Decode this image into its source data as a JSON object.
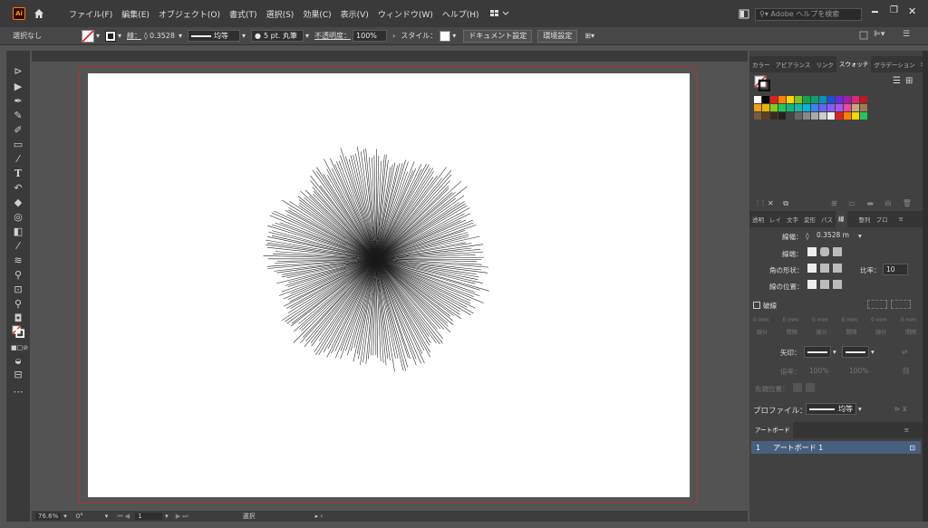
{
  "app": {
    "logo_text": "Ai"
  },
  "menu": {
    "items": [
      "ファイル(F)",
      "編集(E)",
      "オブジェクト(O)",
      "書式(T)",
      "選択(S)",
      "効果(C)",
      "表示(V)",
      "ウィンドウ(W)",
      "ヘルプ(H)"
    ],
    "search_placeholder": "Adobe ヘルプを検索"
  },
  "control_bar": {
    "selection": "選択なし",
    "stroke_label": "線：",
    "stroke_value": "0.3528",
    "profile_label": "均等",
    "brush_label": "5 pt. 丸筆",
    "opacity_label": "不透明度：",
    "opacity_value": "100%",
    "style_label": "スタイル：",
    "doc_setup": "ドキュメント設定",
    "preferences": "環境設定"
  },
  "status": {
    "zoom": "76.6%",
    "rotation": "0°",
    "artboard_num": "1",
    "mode": "選択"
  },
  "swatches_panel": {
    "tabs": [
      "カラー",
      "アピアランス",
      "リンク",
      "スウォッチ",
      "グラデーション"
    ],
    "active_tab": "スウォッチ"
  },
  "stroke_panel": {
    "tabs": [
      "透明",
      "レイ",
      "文字",
      "変形",
      "パス",
      "線",
      "整列",
      "プロ"
    ],
    "active_tab": "線",
    "weight_label": "線幅：",
    "weight_value": "0.3528 m",
    "cap_label": "線端：",
    "corner_label": "角の形状：",
    "limit_label": "比率：",
    "limit_value": "10",
    "align_label": "線の位置：",
    "dashed_label": "破線",
    "dash_cells": [
      "0 mm",
      "0 mm",
      "0 mm",
      "0 mm",
      "0 mm",
      "0 mm"
    ],
    "dash_sub": [
      "線分",
      "間隔",
      "線分",
      "間隔",
      "線分",
      "間隔"
    ],
    "arrow_label": "矢印：",
    "scale_label": "倍率：",
    "scale_a": "100%",
    "scale_b": "100%",
    "arrow_align_label": "先端位置：",
    "profile_label": "プロファイル：",
    "profile_value": "均等"
  },
  "artboards_panel": {
    "tab": "アートボード",
    "rows": [
      {
        "num": "1",
        "name": "アートボード 1"
      }
    ]
  },
  "colors": {
    "menubar": "#3a3a3a",
    "panel": "#414141",
    "selected_row": "#46607e",
    "artboard_border": "#aa3333"
  }
}
